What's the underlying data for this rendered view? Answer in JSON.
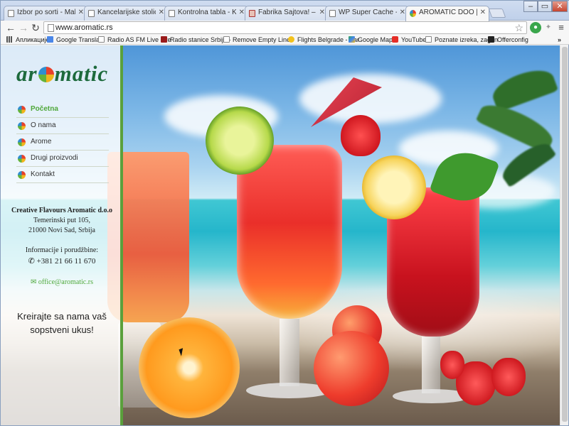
{
  "browser": {
    "tabs": [
      {
        "title": "Izbor po sorti - Malvazija",
        "active": false
      },
      {
        "title": "Kancelarijske stolice i namještaj",
        "active": false
      },
      {
        "title": "Kontrolna tabla - Kancelarija",
        "active": false
      },
      {
        "title": "Fabrika Sajtova! – Prodaja",
        "active": false
      },
      {
        "title": "WP Super Cache - Fabrika",
        "active": false
      },
      {
        "title": "AROMATIC DOO | Aromatic",
        "active": true
      }
    ],
    "url": "www.aromatic.rs",
    "bookmarks": [
      {
        "label": "Апликације",
        "icon": "apps-grid-icon"
      },
      {
        "label": "Google Translate",
        "icon": "google-translate-icon"
      },
      {
        "label": "Radio AS FM Live stre",
        "icon": "page-icon"
      },
      {
        "label": "Radio stanice Srbije -",
        "icon": "radio-icon"
      },
      {
        "label": "Remove Empty Lines",
        "icon": "page-icon"
      },
      {
        "label": "Flights Belgrade - Bar",
        "icon": "flights-icon"
      },
      {
        "label": "Google Maps",
        "icon": "google-maps-icon"
      },
      {
        "label": "YouTube",
        "icon": "youtube-icon"
      },
      {
        "label": "Poznate izreka, zagon",
        "icon": "page-icon"
      },
      {
        "label": "Offerconfig",
        "icon": "offerconfig-icon"
      }
    ],
    "more_bookmarks": "»"
  },
  "site": {
    "logo": {
      "prefix": "ar",
      "suffix": "matic"
    },
    "nav": [
      {
        "label": "Početna",
        "active": true
      },
      {
        "label": "O nama",
        "active": false
      },
      {
        "label": "Arome",
        "active": false
      },
      {
        "label": "Drugi proizvodi",
        "active": false
      },
      {
        "label": "Kontakt",
        "active": false
      }
    ],
    "company": "Creative Flavours Aromatic d.o.o",
    "address_line1": "Temerinski put 105,",
    "address_line2": "21000 Novi Sad, Srbija",
    "info_label": "Informacije i porudžbine:",
    "phone": "+381 21 66 11 670",
    "email": "office@aromatic.rs",
    "slogan_line1": "Kreirajte sa nama vaš",
    "slogan_line2": "sopstveni ukus!"
  },
  "colors": {
    "accent_green": "#4fa83a",
    "logo_green": "#1d6a3c"
  }
}
